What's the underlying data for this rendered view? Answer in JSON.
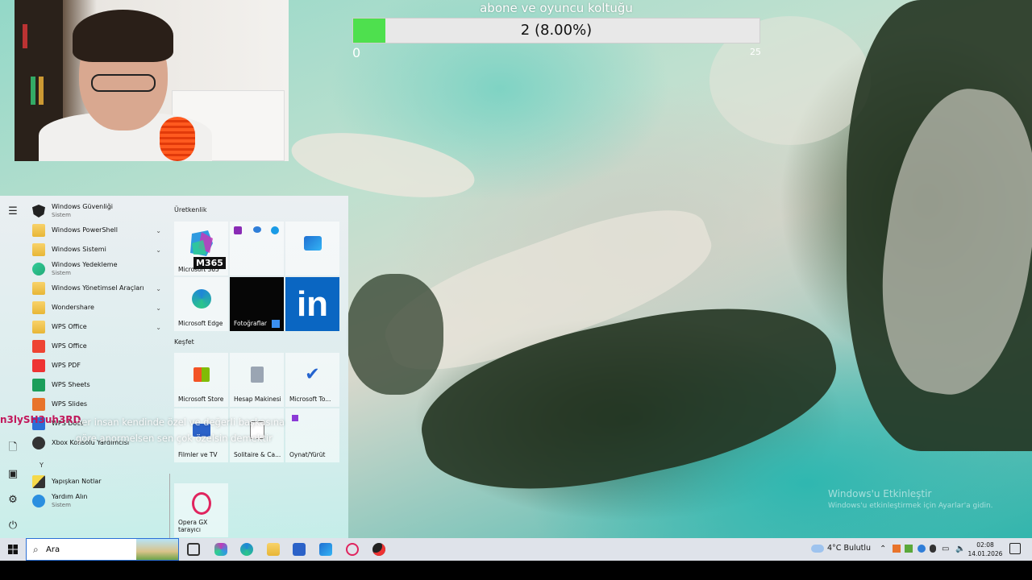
{
  "goal": {
    "title": "abone ve oyuncu koltuğu",
    "progress_text": "2 (8.00%)",
    "progress": 0.08,
    "min": "0",
    "max": "25",
    "fill_color": "#4ee04e"
  },
  "start_menu": {
    "rail": {
      "menu": "menu-icon",
      "documents": "document-icon",
      "pictures": "pictures-icon",
      "settings": "gear-icon",
      "power": "power-icon"
    },
    "apps": [
      {
        "name": "Windows Güvenliği",
        "sub": "Sistem"
      },
      {
        "name": "Windows PowerShell",
        "sub": ""
      },
      {
        "name": "Windows Sistemi",
        "sub": ""
      },
      {
        "name": "Windows Yedekleme",
        "sub": "Sistem"
      },
      {
        "name": "Windows Yönetimsel Araçları",
        "sub": ""
      },
      {
        "name": "Wondershare",
        "sub": ""
      },
      {
        "name": "WPS Office",
        "sub": ""
      },
      {
        "name": "WPS Office",
        "sub": ""
      },
      {
        "name": "WPS PDF",
        "sub": ""
      },
      {
        "name": "WPS Sheets",
        "sub": ""
      },
      {
        "name": "WPS Slides",
        "sub": ""
      },
      {
        "name": "WPS Docs",
        "sub": ""
      },
      {
        "name": "Xbox Konsolu Yardımcısı",
        "sub": ""
      },
      {
        "name": "Yapışkan Notlar",
        "sub": ""
      },
      {
        "name": "Yardım Alın",
        "sub": "Sistem"
      }
    ],
    "letter_y": "Y",
    "group_productivity": "Üretkenlik",
    "group_explore": "Keşfet",
    "tiles": {
      "m365": {
        "label": "Microsoft 365",
        "badge": "M365"
      },
      "edge": "Microsoft Edge",
      "photos": "Fotoğraflar",
      "linkedin": "in",
      "store": "Microsoft Store",
      "calculator": "Hesap Makinesi",
      "todo": "Microsoft To...",
      "movies": "Filmler ve TV",
      "solitaire": "Solitaire & Ca...",
      "play": "Oynat/Yürüt",
      "opera": "Opera GX tarayıcı"
    }
  },
  "chat": {
    "user": "n3lySH3uh3RD",
    "message": "her insan kendinde özel ve değerli başkasına göre anormelsen sen çok özelsin demektir"
  },
  "activate": {
    "line1": "Windows'u Etkinleştir",
    "line2": "Windows'u etkinleştirmek için Ayarlar'a gidin."
  },
  "taskbar": {
    "search_value": "Ara",
    "weather": "4°C  Bulutlu",
    "time": "02:08",
    "date": "14.01.2026"
  }
}
